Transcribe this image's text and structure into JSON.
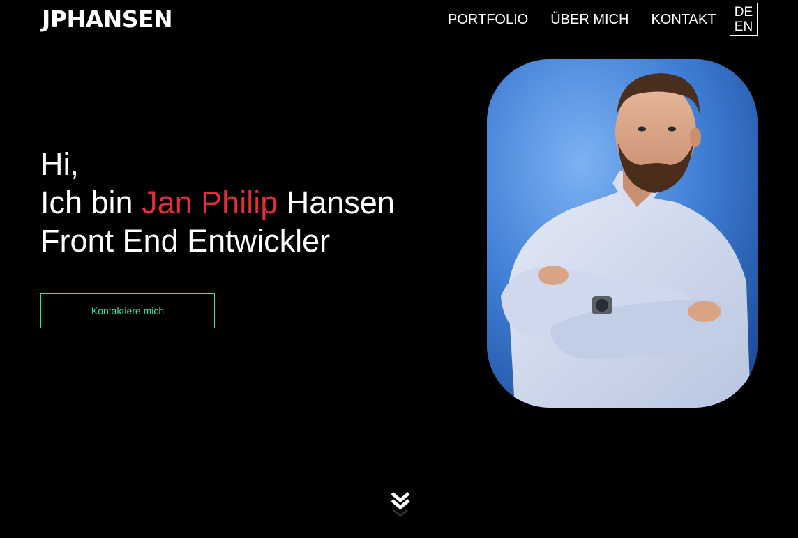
{
  "header": {
    "logo": "JPHANSEN",
    "nav": [
      {
        "label": "PORTFOLIO"
      },
      {
        "label": "ÜBER MICH"
      },
      {
        "label": "KONTAKT"
      }
    ],
    "languages": [
      "DE",
      "EN"
    ]
  },
  "hero": {
    "greeting": "Hi,",
    "intro_prefix": "Ich bin",
    "first_names": "Jan Philip",
    "last_name": "Hansen",
    "role": "Front End Entwickler",
    "cta_label": "Kontaktiere mich"
  },
  "colors": {
    "background": "#000000",
    "text": "#ffffff",
    "name_accent": "#e0303c",
    "cta_accent": "#34e3b0"
  },
  "icons": {
    "scroll": "double-chevron-down-icon"
  }
}
